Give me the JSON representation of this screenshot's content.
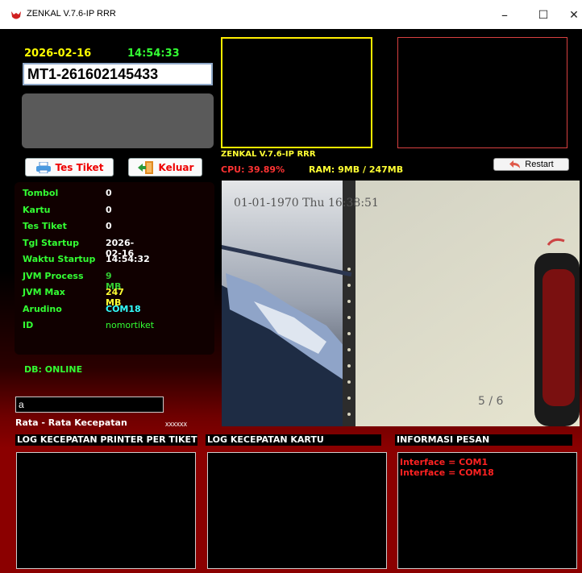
{
  "window": {
    "title": "ZENKAL V.7.6-IP RRR",
    "minimize_glyph": "–",
    "maximize_glyph": "☐",
    "close_glyph": "✕"
  },
  "header": {
    "date": "2026-02-16",
    "time": "14:54:33",
    "ticket_id": "MT1-261602145433"
  },
  "buttons": {
    "tes_tiket": "Tes Tiket",
    "keluar": "Keluar",
    "restart": "Restart"
  },
  "info": [
    {
      "label": "Tombol",
      "value": "0",
      "value_color": "#ffffff"
    },
    {
      "label": "Kartu",
      "value": "0",
      "value_color": "#ffffff"
    },
    {
      "label": "Tes Tiket",
      "value": "0",
      "value_color": "#ffffff"
    },
    {
      "label": "Tgl Startup",
      "value": "2026-02-16",
      "value_color": "#ffffff"
    },
    {
      "label": "Waktu Startup",
      "value": "14:54:32",
      "value_color": "#ffffff"
    },
    {
      "label": "JVM Process",
      "value": "9 MB",
      "value_color": "#33cc33"
    },
    {
      "label": "JVM Max",
      "value": "247 MB",
      "value_color": "#ffff33"
    },
    {
      "label": "Arudino",
      "value": "COM18",
      "value_color": "#33ffff"
    },
    {
      "label": "ID",
      "value": "nomortiket",
      "value_color": "#33ff33"
    }
  ],
  "db_status": "DB: ONLINE",
  "app_label": "ZENKAL V.7.6-IP RRR",
  "cpu": "CPU: 39.89%",
  "ram": "RAM: 9MB / 247MB",
  "camera": {
    "timestamp": "01-01-1970 Thu 16:38:51",
    "counter": "5 / 6"
  },
  "speed": {
    "input_value": "a",
    "label": "Rata - Rata Kecepatan",
    "value": "xxxxxx"
  },
  "sections": {
    "printer_log": "LOG KECEPATAN PRINTER PER TIKET",
    "card_log": "LOG KECEPATAN KARTU",
    "info_msg": "INFORMASI PESAN"
  },
  "messages": [
    "Interface = COM1",
    "Interface = COM18"
  ],
  "colors": {
    "accent_yellow": "#ffff00",
    "accent_green": "#33ff33",
    "accent_red": "#ff2222",
    "frame_red": "#d84040"
  }
}
